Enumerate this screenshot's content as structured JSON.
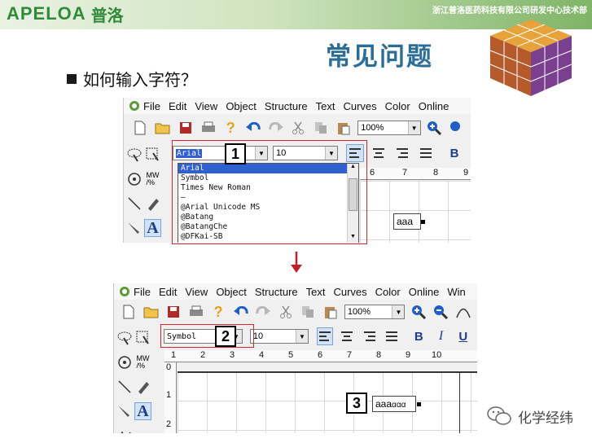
{
  "header": {
    "logo_text": "APELOA",
    "logo_cn": "普洛",
    "company": "浙江普洛医药科技有限公司研发中心技术部"
  },
  "slide": {
    "title": "常见问题",
    "question": "如何输入字符？"
  },
  "menu": [
    "File",
    "Edit",
    "View",
    "Object",
    "Structure",
    "Text",
    "Curves",
    "Color",
    "Online"
  ],
  "menu2": [
    "File",
    "Edit",
    "View",
    "Object",
    "Structure",
    "Text",
    "Curves",
    "Color",
    "Online",
    "Win"
  ],
  "step1": {
    "zoom": "100%",
    "font": "Arial",
    "size": "10",
    "badge": "1",
    "bold_label": "B",
    "font_options": [
      "Arial",
      "Symbol",
      "Times New Roman",
      "–",
      "@Arial Unicode MS",
      "@Batang",
      "@BatangChe",
      "@DFKai-SB"
    ],
    "ruler_labels": [
      "6",
      "7",
      "8",
      "9"
    ],
    "textbox": "aaa",
    "text_tool": "A"
  },
  "step2": {
    "zoom": "100%",
    "font": "Symbol",
    "size": "10",
    "badge2": "2",
    "badge3": "3",
    "bold_label": "B",
    "italic_label": "I",
    "underline_label": "U",
    "ruler_labels": [
      "1",
      "2",
      "3",
      "4",
      "5",
      "6",
      "7",
      "8",
      "9",
      "10"
    ],
    "vruler_labels": [
      "0",
      "1",
      "2"
    ],
    "textbox_plain": "aaa",
    "textbox_symbol": "ααα",
    "text_tool": "A"
  },
  "watermark": "化学经纬",
  "colors": {
    "title": "#2a6e98",
    "logo": "#2f8a3a",
    "callout": "#d9232d",
    "selection": "#2f5fd0",
    "undo": "#1f5fc7"
  }
}
